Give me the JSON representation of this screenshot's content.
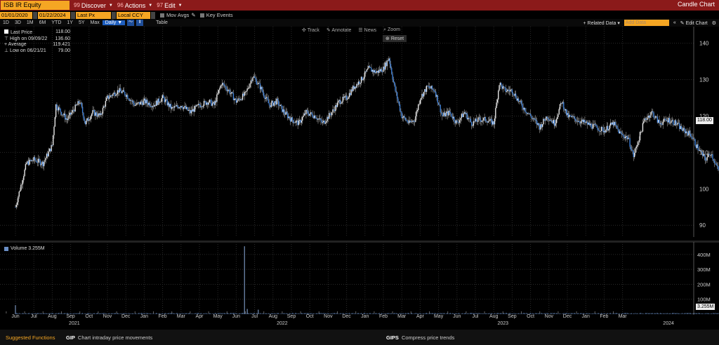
{
  "header": {
    "ticker": "ISB IR Equity",
    "menus": [
      {
        "num": "99",
        "label": "Discover"
      },
      {
        "num": "96",
        "label": "Actions"
      },
      {
        "num": "97",
        "label": "Edit"
      }
    ],
    "title": "Candle Chart"
  },
  "inputs": {
    "start_date": "01/01/2020",
    "end_date": "01/22/2024",
    "field": "Last Px",
    "currency": "Local CCY",
    "mov_avgs": "Mov Avgs",
    "key_events": "Key Events"
  },
  "periods": [
    "1D",
    "3D",
    "1M",
    "6M",
    "YTD",
    "1Y",
    "5Y",
    "Max",
    "Daily"
  ],
  "selected_period": "Daily",
  "table_label": "Table",
  "right_controls": {
    "related": "Related Data",
    "add_data": "Add Data",
    "edit_chart": "Edit Chart"
  },
  "tools": [
    "Track",
    "Annotate",
    "News",
    "Zoom"
  ],
  "reset_label": "Reset",
  "legend": [
    {
      "label": "Last Price",
      "value": "118.00"
    },
    {
      "label": "High on 09/09/22",
      "value": "136.60"
    },
    {
      "label": "Average",
      "value": "119.421"
    },
    {
      "label": "Low on 06/21/21",
      "value": "79.00"
    }
  ],
  "volume_label": "Volume 3.255M",
  "last_badge": "118.00",
  "vol_badge": "3.255M",
  "bottom": {
    "suggested": "Suggested Functions",
    "f1_code": "GIP",
    "f1_desc": "Chart intraday price movements",
    "f2_code": "GIPS",
    "f2_desc": "Compress price trends"
  },
  "chart_data": {
    "type": "line",
    "price_axis": {
      "ticks": [
        90,
        100,
        110,
        120,
        130,
        140
      ],
      "ylim": [
        86,
        143
      ]
    },
    "volume_axis": {
      "ticks": [
        "400M",
        "300M",
        "200M",
        "100M"
      ],
      "ylim": [
        0,
        470
      ]
    },
    "months": [
      "Jun",
      "Jul",
      "Aug",
      "Sep",
      "Oct",
      "Nov",
      "Dec",
      "Jan",
      "Feb",
      "Mar",
      "Apr",
      "May",
      "Jun",
      "Jul",
      "Aug",
      "Sep",
      "Oct",
      "Nov",
      "Dec",
      "Jan",
      "Feb",
      "Mar",
      "Apr",
      "May",
      "Jun",
      "Jul",
      "Aug",
      "Sep",
      "Oct",
      "Nov",
      "Dec",
      "Jan",
      "Feb",
      "Mar"
    ],
    "years": [
      "2021",
      "2022",
      "2023",
      "2024"
    ],
    "price_path": [
      [
        0,
        95
      ],
      [
        0.3,
        101
      ],
      [
        0.6,
        107
      ],
      [
        1,
        108
      ],
      [
        1.5,
        107
      ],
      [
        2,
        112
      ],
      [
        2.2,
        123
      ],
      [
        2.8,
        119
      ],
      [
        3.2,
        122
      ],
      [
        3.5,
        124
      ],
      [
        3.8,
        118
      ],
      [
        4.2,
        121
      ],
      [
        4.6,
        120
      ],
      [
        5,
        125
      ],
      [
        5.6,
        127
      ],
      [
        6,
        126
      ],
      [
        6.5,
        123
      ],
      [
        7,
        124
      ],
      [
        7.5,
        123
      ],
      [
        8,
        125
      ],
      [
        8.5,
        122
      ],
      [
        9,
        123
      ],
      [
        9.5,
        121
      ],
      [
        10,
        123
      ],
      [
        10.5,
        124
      ],
      [
        10.8,
        123
      ],
      [
        11.2,
        129
      ],
      [
        11.6,
        127
      ],
      [
        12,
        124
      ],
      [
        12.5,
        126
      ],
      [
        12.9,
        131
      ],
      [
        13.3,
        128
      ],
      [
        13.8,
        123
      ],
      [
        14.2,
        124
      ],
      [
        14.6,
        121
      ],
      [
        15,
        119
      ],
      [
        15.4,
        118
      ],
      [
        15.8,
        121
      ],
      [
        16.3,
        120
      ],
      [
        16.7,
        118
      ],
      [
        17.2,
        121
      ],
      [
        17.6,
        124
      ],
      [
        18,
        125
      ],
      [
        18.4,
        128
      ],
      [
        18.8,
        130
      ],
      [
        19.2,
        133
      ],
      [
        19.6,
        132
      ],
      [
        20,
        133
      ],
      [
        20.3,
        136
      ],
      [
        20.6,
        128
      ],
      [
        21,
        120
      ],
      [
        21.4,
        118
      ],
      [
        21.7,
        119
      ],
      [
        22,
        125
      ],
      [
        22.4,
        128
      ],
      [
        22.8,
        127
      ],
      [
        23.2,
        120
      ],
      [
        23.6,
        121
      ],
      [
        24,
        118
      ],
      [
        24.4,
        121
      ],
      [
        24.8,
        118
      ],
      [
        25.2,
        119
      ],
      [
        25.6,
        119
      ],
      [
        26,
        118
      ],
      [
        26.3,
        129
      ],
      [
        26.6,
        127
      ],
      [
        27,
        127
      ],
      [
        27.5,
        123
      ],
      [
        28,
        120
      ],
      [
        28.5,
        117
      ],
      [
        28.9,
        120
      ],
      [
        29.3,
        118
      ],
      [
        29.7,
        124
      ],
      [
        30,
        120
      ],
      [
        30.5,
        119
      ],
      [
        31,
        118
      ],
      [
        31.5,
        117
      ],
      [
        32,
        116
      ],
      [
        32.5,
        118
      ],
      [
        32.9,
        115
      ],
      [
        33.3,
        114
      ],
      [
        33.6,
        109
      ],
      [
        33.9,
        114
      ],
      [
        34.2,
        119
      ],
      [
        34.6,
        121
      ],
      [
        35,
        118
      ],
      [
        35.5,
        119
      ],
      [
        35.9,
        118
      ],
      [
        36.3,
        116
      ],
      [
        36.7,
        115
      ],
      [
        37,
        112
      ],
      [
        37.5,
        108
      ],
      [
        37.8,
        110
      ],
      [
        38.2,
        105
      ],
      [
        38.6,
        105
      ],
      [
        39,
        103
      ],
      [
        39.4,
        100
      ],
      [
        39.8,
        106
      ],
      [
        40.2,
        103
      ],
      [
        40.5,
        101
      ],
      [
        40.9,
        105
      ],
      [
        41.3,
        108
      ],
      [
        41.7,
        108
      ],
      [
        42.1,
        111
      ],
      [
        42.5,
        110
      ],
      [
        42.9,
        114
      ],
      [
        43.2,
        125
      ],
      [
        43.5,
        122
      ],
      [
        43.8,
        118
      ],
      [
        44.2,
        120
      ]
    ],
    "volume_spikes": [
      [
        0,
        60
      ],
      [
        12.45,
        455
      ],
      [
        12.6,
        35
      ],
      [
        13.2,
        30
      ]
    ]
  }
}
